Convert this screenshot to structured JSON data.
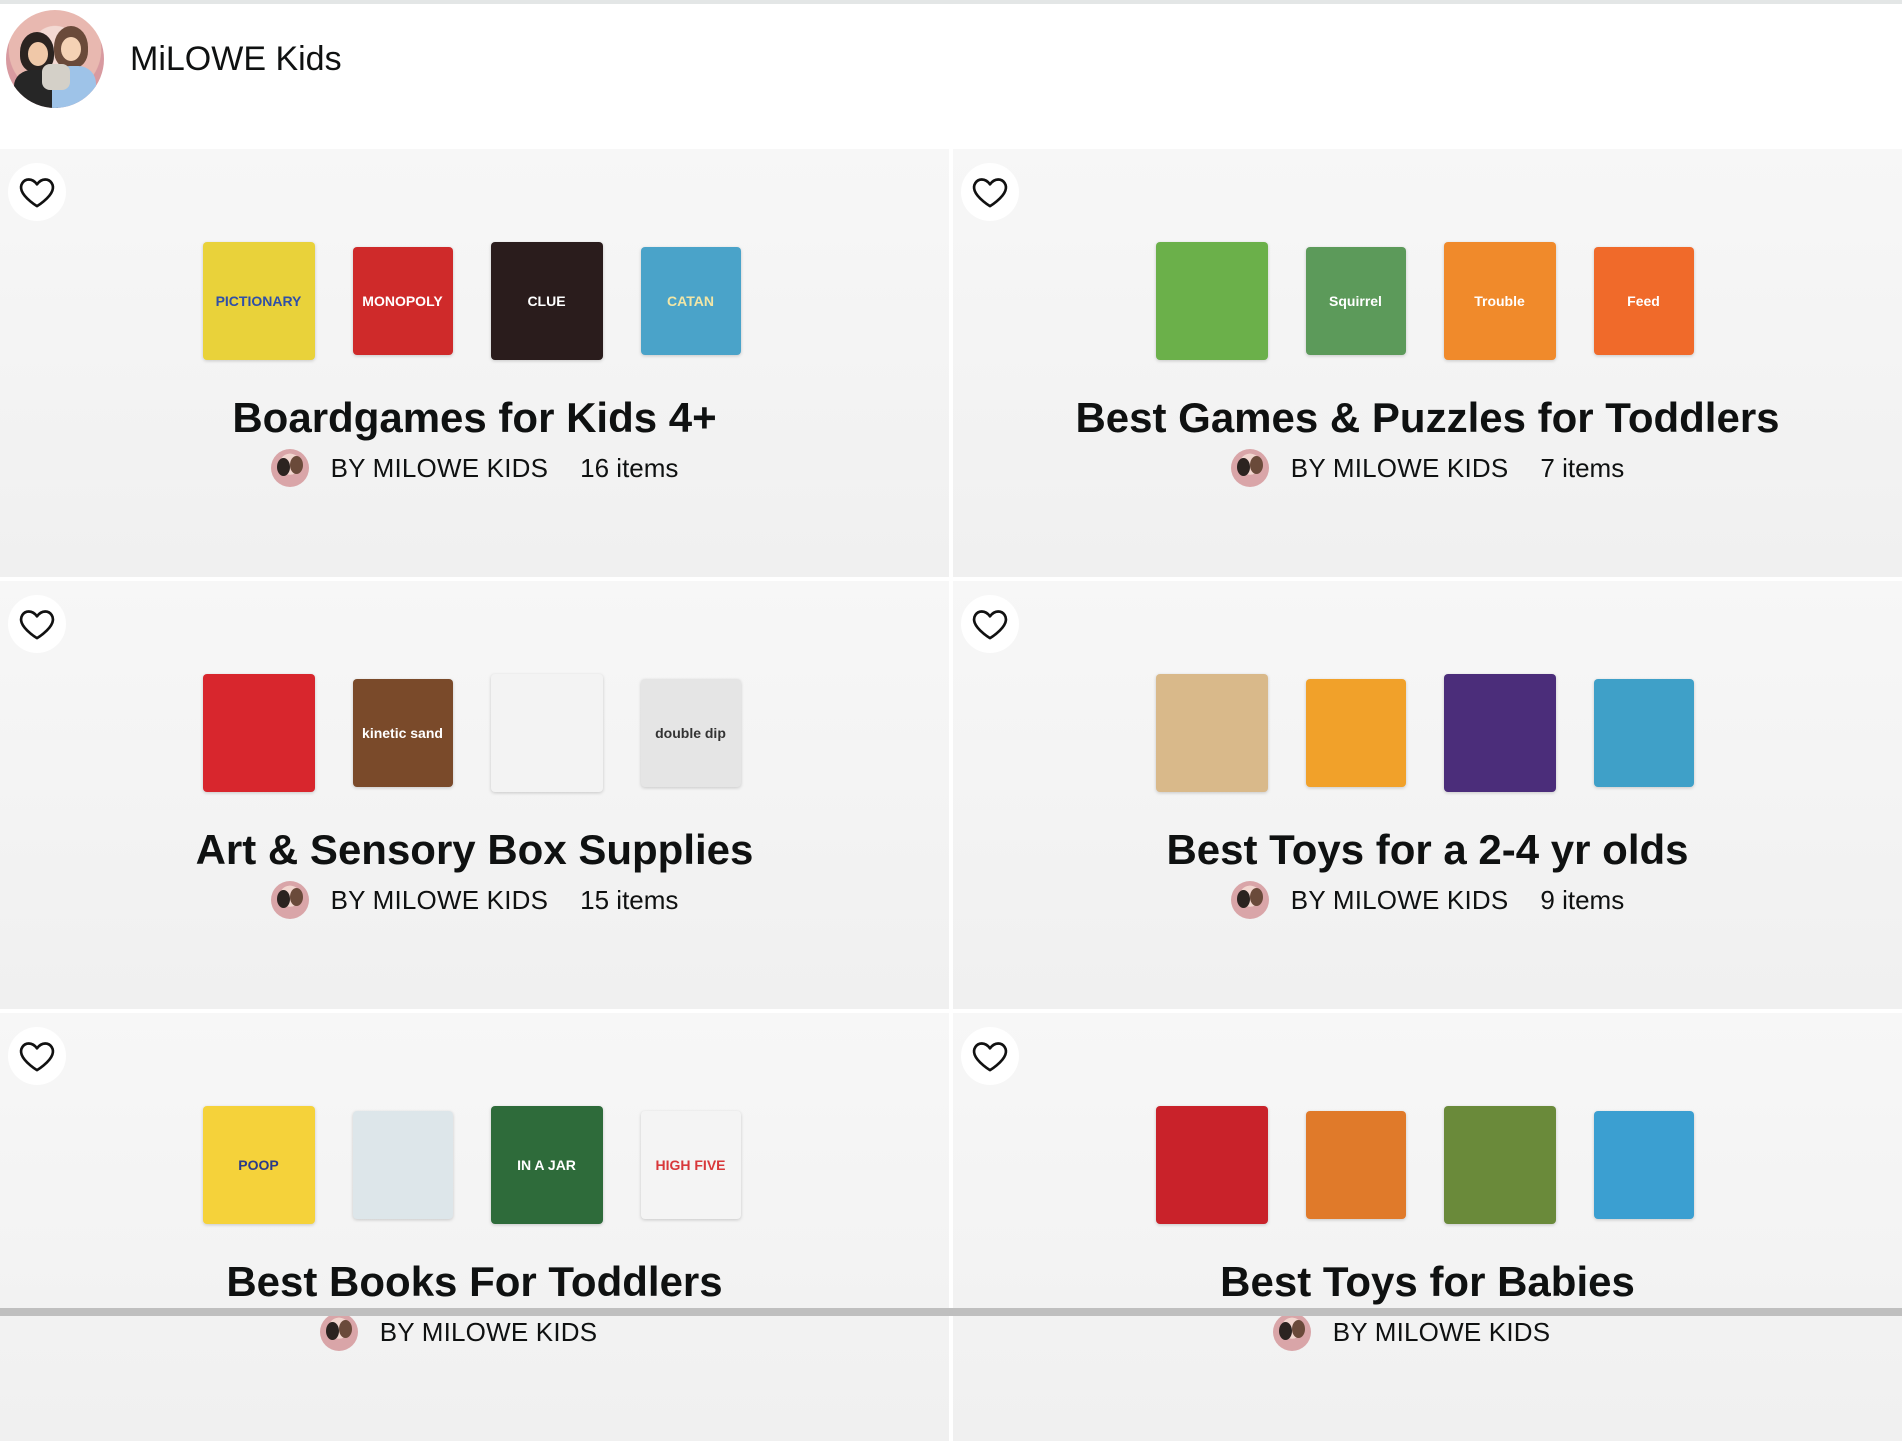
{
  "shop": {
    "name": "MiLOWE Kids"
  },
  "lists": [
    {
      "title": "Boardgames for Kids 4+",
      "by": "BY MILOWE KIDS",
      "count": "16 items",
      "thumbs": [
        {
          "label": "PICTIONARY",
          "bg": "#e9d23a",
          "fg": "#2f4fa8"
        },
        {
          "label": "MONOPOLY",
          "bg": "#cf2a2a",
          "fg": "#ffffff"
        },
        {
          "label": "CLUE",
          "bg": "#2a1c1c",
          "fg": "#ffffff"
        },
        {
          "label": "CATAN",
          "bg": "#4aa3c9",
          "fg": "#f1e6a6"
        }
      ]
    },
    {
      "title": "Best Games & Puzzles for Toddlers",
      "by": "BY MILOWE KIDS",
      "count": "7 items",
      "thumbs": [
        {
          "label": "",
          "bg": "#6bb04a",
          "fg": "#ffffff"
        },
        {
          "label": "Squirrel",
          "bg": "#5c9a5a",
          "fg": "#ffffff"
        },
        {
          "label": "Trouble",
          "bg": "#f08a2b",
          "fg": "#ffffff"
        },
        {
          "label": "Feed",
          "bg": "#f06a2a",
          "fg": "#ffffff"
        }
      ]
    },
    {
      "title": "Art & Sensory Box Supplies",
      "by": "BY MILOWE KIDS",
      "count": "15 items",
      "thumbs": [
        {
          "label": "",
          "bg": "#d8262d",
          "fg": "#ffffff"
        },
        {
          "label": "kinetic sand",
          "bg": "#7a4a2a",
          "fg": "#ffffff"
        },
        {
          "label": "",
          "bg": "#f3f3f3",
          "fg": "#333333"
        },
        {
          "label": "double dip",
          "bg": "#e5e5e5",
          "fg": "#333333"
        }
      ]
    },
    {
      "title": "Best Toys for a 2-4 yr olds",
      "by": "BY MILOWE KIDS",
      "count": "9 items",
      "thumbs": [
        {
          "label": "",
          "bg": "#d9b98a",
          "fg": "#ffffff"
        },
        {
          "label": "",
          "bg": "#f1a12a",
          "fg": "#ffffff"
        },
        {
          "label": "",
          "bg": "#4b2d7a",
          "fg": "#ffffff"
        },
        {
          "label": "",
          "bg": "#3fa0c8",
          "fg": "#ffffff"
        }
      ]
    },
    {
      "title": "Best Books For Toddlers",
      "by": "BY MILOWE KIDS",
      "count": "",
      "thumbs": [
        {
          "label": "POOP",
          "bg": "#f5d23a",
          "fg": "#2a3a8a"
        },
        {
          "label": "",
          "bg": "#dde6ea",
          "fg": "#333333"
        },
        {
          "label": "IN A JAR",
          "bg": "#2e6b3a",
          "fg": "#ffffff"
        },
        {
          "label": "HIGH FIVE",
          "bg": "#f4f4f4",
          "fg": "#d8373a"
        }
      ]
    },
    {
      "title": "Best Toys for Babies",
      "by": "BY MILOWE KIDS",
      "count": "",
      "thumbs": [
        {
          "label": "",
          "bg": "#c9222a",
          "fg": "#ffffff"
        },
        {
          "label": "",
          "bg": "#e07a2a",
          "fg": "#ffffff"
        },
        {
          "label": "",
          "bg": "#6a8a3a",
          "fg": "#ffffff"
        },
        {
          "label": "",
          "bg": "#3b9fd1",
          "fg": "#ffffff"
        }
      ]
    }
  ],
  "icons": {
    "heart": "heart-outline-icon"
  }
}
